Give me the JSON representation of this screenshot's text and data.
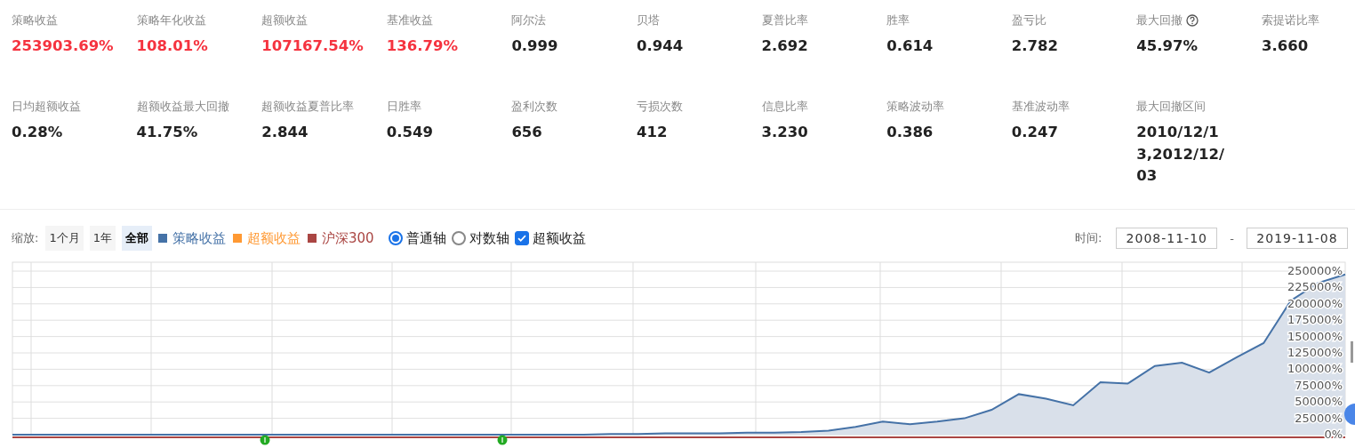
{
  "stats": [
    {
      "label": "策略收益",
      "value": "253903.69%",
      "color": "#f5333f"
    },
    {
      "label": "策略年化收益",
      "value": "108.01%",
      "color": "#f5333f"
    },
    {
      "label": "超额收益",
      "value": "107167.54%",
      "color": "#f5333f"
    },
    {
      "label": "基准收益",
      "value": "136.79%",
      "color": "#f5333f"
    },
    {
      "label": "阿尔法",
      "value": "0.999",
      "color": "#222222"
    },
    {
      "label": "贝塔",
      "value": "0.944",
      "color": "#222222"
    },
    {
      "label": "夏普比率",
      "value": "2.692",
      "color": "#222222"
    },
    {
      "label": "胜率",
      "value": "0.614",
      "color": "#222222"
    },
    {
      "label": "盈亏比",
      "value": "2.782",
      "color": "#222222"
    },
    {
      "label": "最大回撤",
      "value": "45.97%",
      "color": "#222222",
      "help": true
    },
    {
      "label": "索提诺比率",
      "value": "3.660",
      "color": "#222222"
    },
    {
      "label": "日均超额收益",
      "value": "0.28%",
      "color": "#222222"
    },
    {
      "label": "超额收益最大回撤",
      "value": "41.75%",
      "color": "#222222"
    },
    {
      "label": "超额收益夏普比率",
      "value": "2.844",
      "color": "#222222"
    },
    {
      "label": "日胜率",
      "value": "0.549",
      "color": "#222222"
    },
    {
      "label": "盈利次数",
      "value": "656",
      "color": "#222222"
    },
    {
      "label": "亏损次数",
      "value": "412",
      "color": "#222222"
    },
    {
      "label": "信息比率",
      "value": "3.230",
      "color": "#222222"
    },
    {
      "label": "策略波动率",
      "value": "0.386",
      "color": "#222222"
    },
    {
      "label": "基准波动率",
      "value": "0.247",
      "color": "#222222"
    },
    {
      "label": "最大回撤区间",
      "value": "2010/12/13,2012/12/03",
      "color": "#222222"
    }
  ],
  "zoom": {
    "label": "缩放:",
    "buttons": [
      {
        "label": "1个月",
        "selected": false
      },
      {
        "label": "1年",
        "selected": false
      },
      {
        "label": "全部",
        "selected": true
      }
    ]
  },
  "legend": [
    {
      "kind": "series"
    },
    {
      "kind": "plain",
      "label": "超额收益",
      "color": "#ff9933"
    },
    {
      "kind": "plain",
      "label": "沪深300",
      "color": "#aa4643"
    }
  ],
  "axis_options": [
    {
      "label": "普通轴",
      "selected": true
    },
    {
      "label": "对数轴",
      "selected": false
    }
  ],
  "excess_toggle": {
    "label": "超额收益",
    "checked": true
  },
  "time_range": {
    "label": "时间:",
    "start": "2008-11-10",
    "separator": "-",
    "end": "2019-11-08"
  },
  "chart": {
    "chart_data": {
      "type": "area",
      "grid": true,
      "ylim": [
        0,
        263600
      ],
      "yticks": [
        {
          "value": 0,
          "label": "0%"
        },
        {
          "value": 25000,
          "label": "25000%"
        },
        {
          "value": 50000,
          "label": "50000%"
        },
        {
          "value": 75000,
          "label": "75000%"
        },
        {
          "value": 100000,
          "label": "100000%"
        },
        {
          "value": 125000,
          "label": "125000%"
        },
        {
          "value": 150000,
          "label": "150000%"
        },
        {
          "value": 175000,
          "label": "175000%"
        },
        {
          "value": 200000,
          "label": "200000%"
        },
        {
          "value": 225000,
          "label": "225000%"
        },
        {
          "value": 250000,
          "label": "250000%"
        }
      ],
      "series": [
        {
          "name": "策略收益",
          "color": "#4572a7",
          "values": [
            0,
            0,
            0,
            0,
            0,
            0,
            0,
            0,
            0,
            0,
            0,
            0,
            0,
            0,
            0,
            0,
            0,
            0,
            0,
            0,
            0,
            0,
            1000,
            1000,
            2000,
            2000,
            2000,
            3000,
            3000,
            4000,
            6000,
            12000,
            20000,
            16000,
            20000,
            25000,
            38000,
            62000,
            55000,
            45000,
            80000,
            78000,
            105000,
            110000,
            95000,
            118000,
            140000,
            205000,
            232000,
            245000
          ]
        }
      ]
    }
  }
}
